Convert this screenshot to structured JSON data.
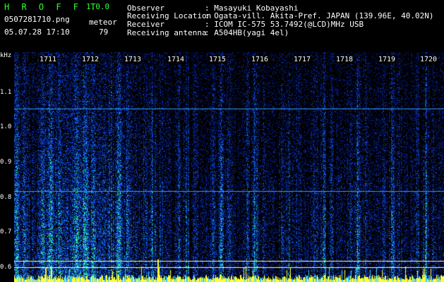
{
  "header": {
    "program_title": "H R O F F T",
    "version": "1.0.0",
    "filename": "0507281710.png",
    "datetime": "05.07.28 17:10",
    "meteor_label": "meteor",
    "meteor_count": "79",
    "observer_label": "Observer",
    "observer_value": ": Masayuki Kobayashi",
    "location_label": "Receiving Location",
    "location_value": ": Ogata-vill. Akita-Pref. JAPAN (139.96E, 40.02N)",
    "receiver_label": "Receiver",
    "receiver_value": ": ICOM IC-575 53.7492(@LCD)MHz USB",
    "antenna_label": "Receiving antenna",
    "antenna_value": ": A504HB(yagi 4el)"
  },
  "spectrogram": {
    "y_unit": "kHz",
    "y_ticks": [
      "1.1",
      "1.0",
      "0.9",
      "0.8",
      "0.7",
      "0.6"
    ],
    "time_ticks": [
      "1711",
      "1712",
      "1713",
      "1714",
      "1715",
      "1716",
      "1717",
      "1718",
      "1719",
      "1720"
    ],
    "colors": {
      "background": "#000000",
      "signal_low": "#0a1e8c",
      "signal_mid": "#1e6cff",
      "signal_high": "#33ff99",
      "peak": "#ffff33",
      "marker_line": "#3399ff"
    }
  }
}
